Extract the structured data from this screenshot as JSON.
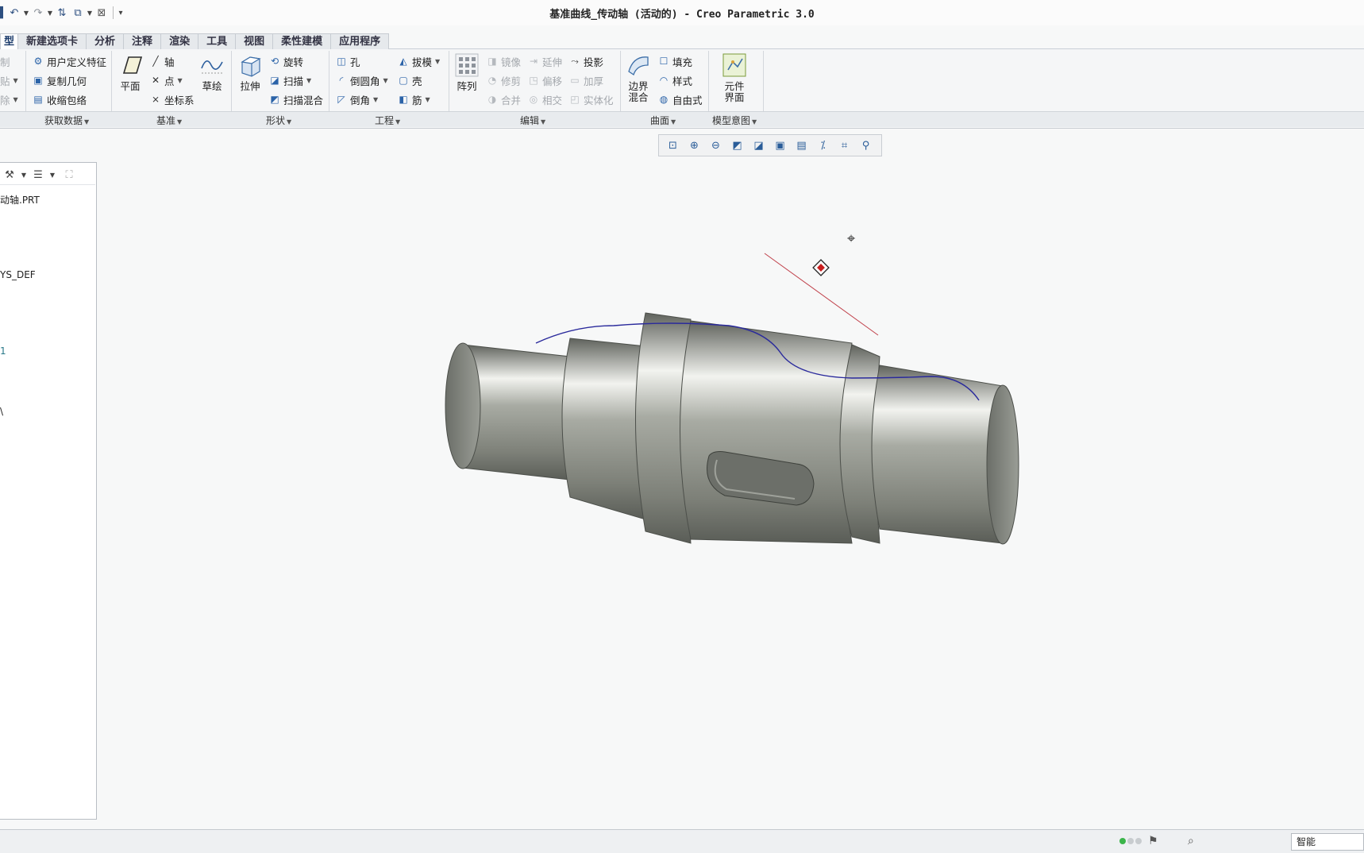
{
  "window": {
    "title": "基准曲线_传动轴 (活动的) - Creo Parametric 3.0"
  },
  "tabs": [
    {
      "label": "型"
    },
    {
      "label": "新建选项卡"
    },
    {
      "label": "分析"
    },
    {
      "label": "注释"
    },
    {
      "label": "渲染"
    },
    {
      "label": "工具"
    },
    {
      "label": "视图"
    },
    {
      "label": "柔性建模"
    },
    {
      "label": "应用程序"
    }
  ],
  "ribbon": {
    "operations": {
      "items": [
        "制",
        "贴",
        "除"
      ]
    },
    "get_data": {
      "label": "获取数据",
      "items": [
        "用户定义特征",
        "复制几何",
        "收缩包络"
      ]
    },
    "datum": {
      "label": "基准",
      "plane": "平面",
      "items": [
        "轴",
        "点",
        "坐标系"
      ],
      "sketch": "草绘"
    },
    "shapes": {
      "label": "形状",
      "extrude": "拉伸",
      "items": [
        "旋转",
        "扫描",
        "扫描混合"
      ]
    },
    "engineering": {
      "label": "工程",
      "col1": [
        "孔",
        "倒圆角",
        "倒角"
      ],
      "col2": [
        "拔模",
        "壳",
        "筋"
      ]
    },
    "editing": {
      "label": "编辑",
      "pattern": "阵列",
      "col1": [
        "镜像",
        "修剪",
        "合并"
      ],
      "col2": [
        "延伸",
        "偏移",
        "相交"
      ],
      "col3": [
        "投影",
        "加厚",
        "实体化"
      ]
    },
    "surfaces": {
      "label": "曲面",
      "boundary_line1": "边界",
      "boundary_line2": "混合",
      "items": [
        "填充",
        "样式",
        "自由式"
      ]
    },
    "model_intent": {
      "label": "模型意图",
      "component_line1": "元件",
      "component_line2": "界面"
    }
  },
  "model_tree": {
    "items": [
      "动轴.PRT",
      "YS_DEF",
      "1",
      "\\"
    ]
  },
  "statusbar": {
    "filter": "智能"
  },
  "colors": {
    "curve": "#2a2a9c",
    "axis": "#c0404a",
    "model": "#8c8f88"
  }
}
